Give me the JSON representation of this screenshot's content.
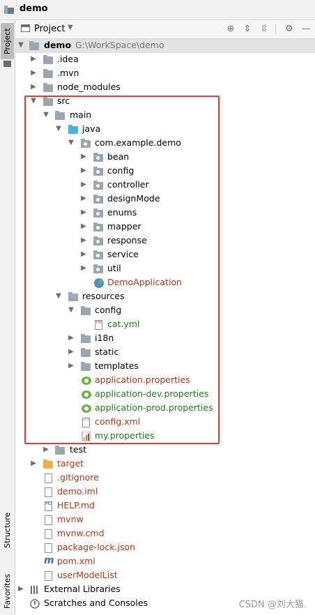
{
  "window": {
    "title": "demo",
    "side_tabs": [
      "Project",
      "Structure",
      "Favorites"
    ]
  },
  "toolbar": {
    "view_label": "Project",
    "caret": "▼",
    "icons": [
      "crosshair-icon",
      "expand-all-icon",
      "collapse-all-icon",
      "gear-icon",
      "minimize-icon"
    ]
  },
  "tree": [
    {
      "label": "demo",
      "path": "G:\\WorkSpace\\demo"
    },
    {
      "label": ".idea"
    },
    {
      "label": ".mvn"
    },
    {
      "label": "node_modules"
    },
    {
      "label": "src"
    },
    {
      "label": "main"
    },
    {
      "label": "java"
    },
    {
      "label": "com.example.demo"
    },
    {
      "label": "bean"
    },
    {
      "label": "config"
    },
    {
      "label": "controller"
    },
    {
      "label": "designMode"
    },
    {
      "label": "enums"
    },
    {
      "label": "mapper"
    },
    {
      "label": "response"
    },
    {
      "label": "service"
    },
    {
      "label": "util"
    },
    {
      "label": "DemoApplication"
    },
    {
      "label": "resources"
    },
    {
      "label": "config"
    },
    {
      "label": "cat.yml"
    },
    {
      "label": "i18n"
    },
    {
      "label": "static"
    },
    {
      "label": "templates"
    },
    {
      "label": "application.properties"
    },
    {
      "label": "application-dev.properties"
    },
    {
      "label": "application-prod.properties"
    },
    {
      "label": "config.xml"
    },
    {
      "label": "my.properties"
    },
    {
      "label": "test"
    },
    {
      "label": "target"
    },
    {
      "label": ".gitignore"
    },
    {
      "label": "demo.iml"
    },
    {
      "label": "HELP.md"
    },
    {
      "label": "mvnw"
    },
    {
      "label": "mvnw.cmd"
    },
    {
      "label": "package-lock.json"
    },
    {
      "label": "pom.xml"
    },
    {
      "label": "userModelList"
    },
    {
      "label": "External Libraries"
    },
    {
      "label": "Scratches and Consoles"
    }
  ],
  "file_badges": {
    "yml": "YML",
    "md": "MD",
    "xml": "<>"
  },
  "watermark": "CSDN @刘大猫.",
  "colors": {
    "highlight_box": "#e83a3a",
    "folder_blue": "#40b6e0",
    "folder_orange": "#f4af3d",
    "spring_green": "#6db33f",
    "text_green": "#217a21",
    "text_brown": "#a63a1f"
  }
}
